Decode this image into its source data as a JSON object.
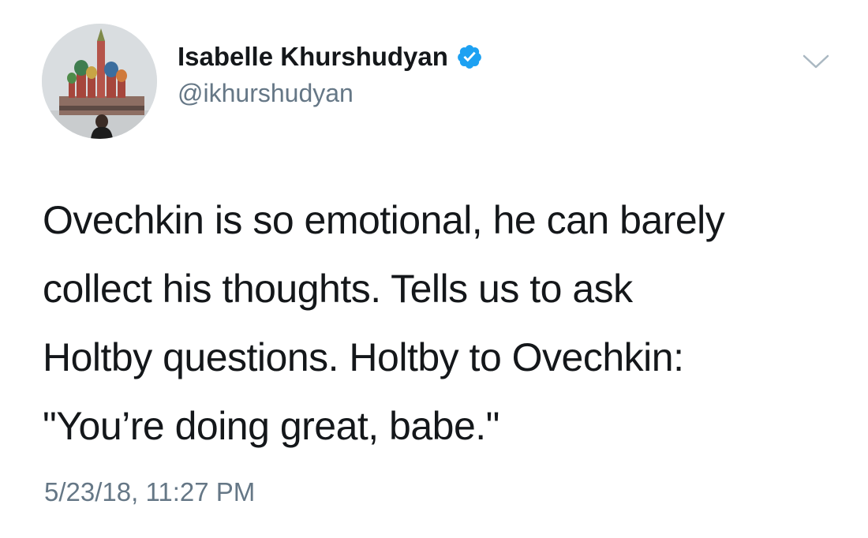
{
  "user": {
    "display_name": "Isabelle Khurshudyan",
    "handle": "@ikhurshudyan",
    "verified": true,
    "avatar_icon": "avatar-photo"
  },
  "tweet": {
    "text_lines": [
      "Ovechkin is so emotional, he can barely",
      "collect his thoughts. Tells us to ask",
      "Holtby questions. Holtby to Ovechkin:",
      "\"You’re doing great, babe.\""
    ],
    "timestamp": "5/23/18, 11:27 PM"
  },
  "icons": {
    "verified": "verified-badge-icon",
    "menu": "chevron-down-icon"
  },
  "colors": {
    "text": "#14171a",
    "secondary_text": "#657786",
    "verified_blue": "#1da1f2",
    "chevron": "#aab8c2"
  }
}
